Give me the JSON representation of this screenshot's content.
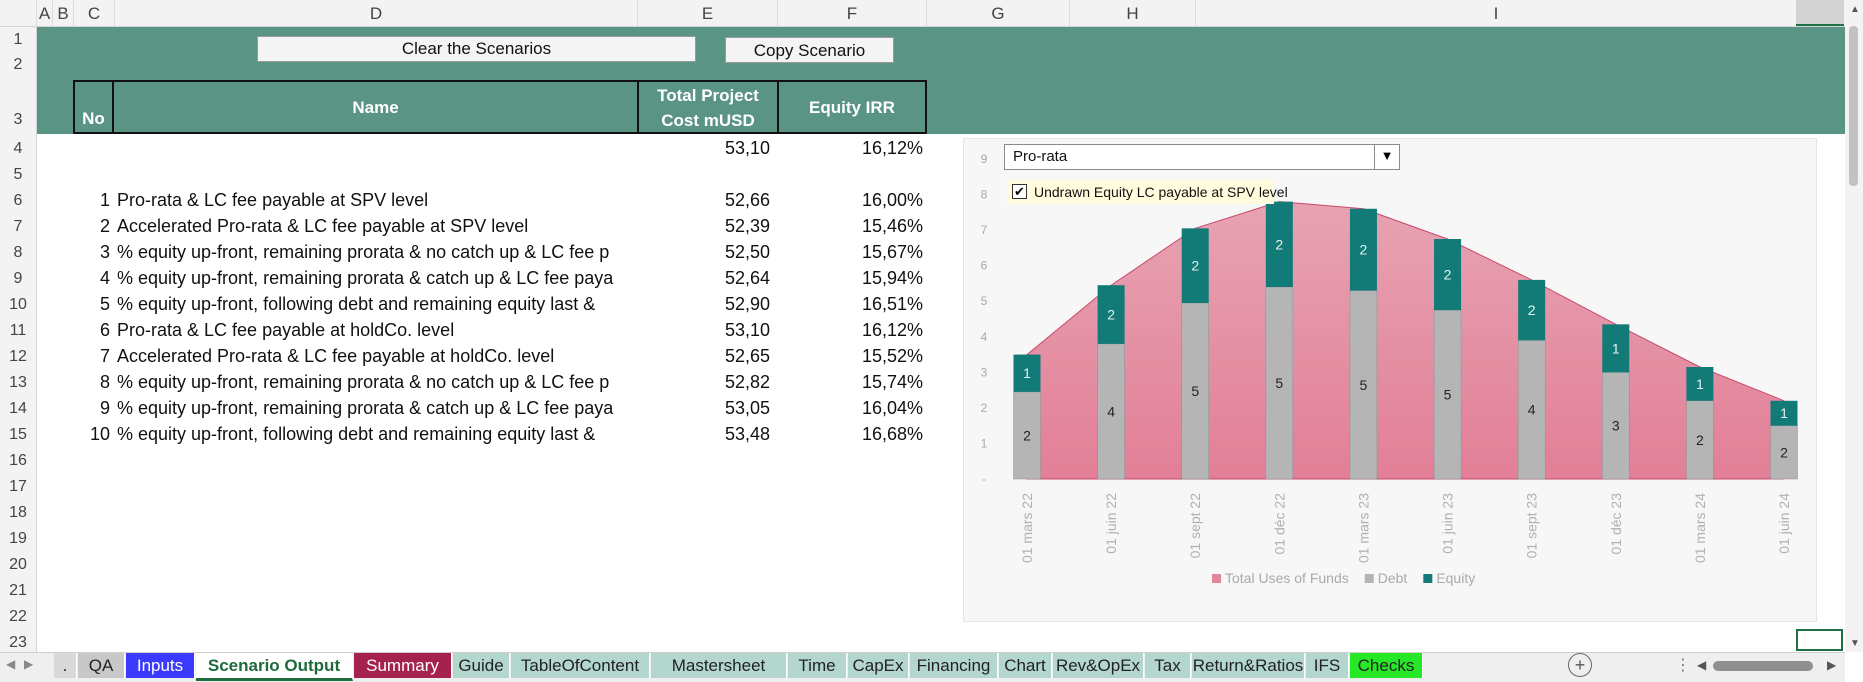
{
  "sheet": {
    "columns": [
      "A",
      "B",
      "C",
      "D",
      "E",
      "F",
      "G",
      "H",
      "I"
    ],
    "rows": [
      "1",
      "2",
      "3",
      "4",
      "5",
      "6",
      "7",
      "8",
      "9",
      "10",
      "11",
      "12",
      "13",
      "14",
      "15",
      "16",
      "17",
      "18",
      "19",
      "20",
      "21",
      "22",
      "23"
    ]
  },
  "buttons": {
    "clear": "Clear the Scenarios",
    "copy": "Copy Scenario"
  },
  "table": {
    "headers": {
      "no": "No",
      "name": "Name",
      "cost_line1": "Total Project",
      "cost_line2": "Cost mUSD",
      "irr": "Equity IRR"
    },
    "current": {
      "cost": "53,10",
      "irr": "16,12%"
    },
    "rows": [
      {
        "no": "1",
        "name": "Pro-rata & LC fee payable at SPV level",
        "cost": "52,66",
        "irr": "16,00%"
      },
      {
        "no": "2",
        "name": "Accelerated Pro-rata & LC fee payable at SPV level",
        "cost": "52,39",
        "irr": "15,46%"
      },
      {
        "no": "3",
        "name": "% equity up-front, remaining prorata & no catch up  & LC fee p",
        "cost": "52,50",
        "irr": "15,67%"
      },
      {
        "no": "4",
        "name": "% equity up-front, remaining prorata & catch up  & LC fee paya",
        "cost": "52,64",
        "irr": "15,94%"
      },
      {
        "no": "5",
        "name": "% equity up-front, following debt and remaining equity last  &",
        "cost": "52,90",
        "irr": "16,51%"
      },
      {
        "no": "6",
        "name": "Pro-rata & LC fee payable at holdCo. level",
        "cost": "53,10",
        "irr": "16,12%"
      },
      {
        "no": "7",
        "name": "Accelerated Pro-rata & LC fee payable at holdCo. level",
        "cost": "52,65",
        "irr": "15,52%"
      },
      {
        "no": "8",
        "name": "% equity up-front, remaining prorata & no catch up  & LC fee p",
        "cost": "52,82",
        "irr": "15,74%"
      },
      {
        "no": "9",
        "name": "% equity up-front, remaining prorata & catch up  & LC fee paya",
        "cost": "53,05",
        "irr": "16,04%"
      },
      {
        "no": "10",
        "name": "% equity up-front, following debt and remaining equity last  &",
        "cost": "53,48",
        "irr": "16,68%"
      }
    ]
  },
  "chart_controls": {
    "dropdown_value": "Pro-rata",
    "checkbox_label": "Undrawn Equity LC payable at SPV level",
    "checkbox_checked": true
  },
  "chart_data": {
    "type": "bar",
    "stacked": true,
    "categories": [
      "01 mars 22",
      "01 juin 22",
      "01 sept 22",
      "01 déc 22",
      "01 mars 23",
      "01 juin 23",
      "01 sept 23",
      "01 déc 23",
      "01 mars 24",
      "01 juin 24"
    ],
    "series": [
      {
        "name": "Total Uses of Funds",
        "kind": "area",
        "color": "#e2879b",
        "values": [
          3.5,
          5.45,
          7.05,
          7.8,
          7.6,
          6.75,
          5.6,
          4.35,
          3.15,
          2.2
        ]
      },
      {
        "name": "Debt",
        "kind": "bar",
        "color": "#b5b5b5",
        "values": [
          2.45,
          3.8,
          4.95,
          5.4,
          5.3,
          4.75,
          3.9,
          3.0,
          2.2,
          1.5
        ],
        "labels": [
          "2",
          "4",
          "5",
          "5",
          "5",
          "5",
          "4",
          "3",
          "2",
          "2"
        ]
      },
      {
        "name": "Equity",
        "kind": "bar",
        "color": "#127a77",
        "values": [
          1.05,
          1.65,
          2.1,
          2.4,
          2.3,
          2.0,
          1.7,
          1.35,
          0.95,
          0.7
        ],
        "labels": [
          "1",
          "2",
          "2",
          "2",
          "2",
          "2",
          "2",
          "1",
          "1",
          "1"
        ]
      }
    ],
    "ytick_labels": [
      "-",
      "1",
      "2",
      "3",
      "4",
      "5",
      "6",
      "7",
      "8",
      "9"
    ],
    "ylim": [
      0,
      9
    ],
    "legend": "bottom",
    "grid": false
  },
  "tabs": [
    {
      "label": ".",
      "bg": "#d9d9d9",
      "fg": "#222"
    },
    {
      "label": "QA",
      "bg": "#c8c8c8",
      "fg": "#222"
    },
    {
      "label": "Inputs",
      "bg": "#3b3bff",
      "fg": "#ffffff"
    },
    {
      "label": "Scenario Output",
      "bg": "#ffffff",
      "fg": "#1d6b3a",
      "active": true
    },
    {
      "label": "Summary",
      "bg": "#a5224d",
      "fg": "#ffffff"
    },
    {
      "label": "Guide",
      "bg": "#b3d6ce",
      "fg": "#222"
    },
    {
      "label": "TableOfContent",
      "bg": "#b3d6ce",
      "fg": "#222"
    },
    {
      "label": "Mastersheet",
      "bg": "#b3d6ce",
      "fg": "#222"
    },
    {
      "label": "Time",
      "bg": "#b3d6ce",
      "fg": "#222"
    },
    {
      "label": "CapEx",
      "bg": "#b3d6ce",
      "fg": "#222"
    },
    {
      "label": "Financing",
      "bg": "#b3d6ce",
      "fg": "#222"
    },
    {
      "label": "Chart",
      "bg": "#b3d6ce",
      "fg": "#222"
    },
    {
      "label": "Rev&OpEx",
      "bg": "#b3d6ce",
      "fg": "#222"
    },
    {
      "label": "Tax",
      "bg": "#b3d6ce",
      "fg": "#222"
    },
    {
      "label": "Return&Ratios",
      "bg": "#b3d6ce",
      "fg": "#222"
    },
    {
      "label": "IFS",
      "bg": "#b3d6ce",
      "fg": "#222"
    },
    {
      "label": "Checks",
      "bg": "#26e826",
      "fg": "#222"
    }
  ],
  "colors": {
    "band": "#5a9485",
    "equity": "#127a77",
    "debt": "#b5b5b5",
    "area": "#e2879b"
  }
}
